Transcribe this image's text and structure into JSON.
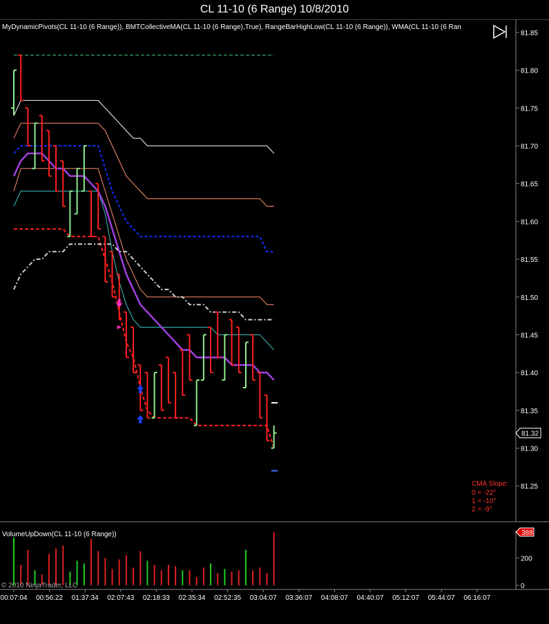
{
  "window": {
    "title": "CL 11-10 (6 Range)  10/8/2010"
  },
  "indicator_legend": "MyDynamicPivots(CL 11-10 (6 Range)), BMTCollectiveMA(CL 11-10 (6 Range),True), RangeBarHighLow(CL 11-10 (6 Range)), WMA(CL 11-10 (6 Ran",
  "volume_legend": "VolumeUpDown(CL 11-10 (6 Range))",
  "copyright": "© 2010 NinjaTrader, LLC",
  "last_price_label": "81.32",
  "last_volume_label": "388",
  "cma_slope": {
    "title": "CMA Slope:",
    "lines": [
      "0 = -22°",
      "1 = -10°",
      "2 = -9°"
    ]
  },
  "colors": {
    "up_bar": "#90ee90",
    "down_bar": "#ff2020",
    "pivot_top": "#2e8b57",
    "wma": "#a040e0",
    "dashed_blue": "#1030ff",
    "support_red": "#ff2020",
    "gray_ma": "#d0d0d0",
    "vol_up": "#20d020",
    "vol_down": "#e02020"
  },
  "chart_data": [
    {
      "type": "candlestick",
      "title": "CL 11-10 (6 Range)  10/8/2010",
      "ylim": [
        81.22,
        81.86
      ],
      "y_ticks": [
        81.85,
        81.8,
        81.75,
        81.7,
        81.65,
        81.6,
        81.55,
        81.5,
        81.45,
        81.4,
        81.35,
        81.3,
        81.25
      ],
      "x_tick_labels": [
        "00:07:04",
        "00:56:22",
        "01:37:34",
        "02:07:43",
        "02:18:33",
        "02:35:34",
        "02:52:35",
        "03:04:07",
        "03:36:07",
        "04:08:07",
        "04:40:07",
        "05:12:07",
        "05:44:07",
        "06:16:07"
      ],
      "bars": [
        {
          "o": 81.75,
          "h": 81.8,
          "l": 81.74,
          "c": 81.8
        },
        {
          "o": 81.82,
          "h": 81.82,
          "l": 81.76,
          "c": 81.76
        },
        {
          "o": 81.75,
          "h": 81.75,
          "l": 81.7,
          "c": 81.7
        },
        {
          "o": 81.67,
          "h": 81.73,
          "l": 81.67,
          "c": 81.73
        },
        {
          "o": 81.74,
          "h": 81.74,
          "l": 81.68,
          "c": 81.68
        },
        {
          "o": 81.72,
          "h": 81.72,
          "l": 81.66,
          "c": 81.66
        },
        {
          "o": 81.7,
          "h": 81.7,
          "l": 81.64,
          "c": 81.64
        },
        {
          "o": 81.68,
          "h": 81.68,
          "l": 81.62,
          "c": 81.62
        },
        {
          "o": 81.58,
          "h": 81.64,
          "l": 81.58,
          "c": 81.64
        },
        {
          "o": 81.61,
          "h": 81.67,
          "l": 81.61,
          "c": 81.67
        },
        {
          "o": 81.64,
          "h": 81.7,
          "l": 81.64,
          "c": 81.7
        },
        {
          "o": 81.64,
          "h": 81.64,
          "l": 81.58,
          "c": 81.58
        },
        {
          "o": 81.65,
          "h": 81.65,
          "l": 81.59,
          "c": 81.59
        },
        {
          "o": 81.58,
          "h": 81.58,
          "l": 81.52,
          "c": 81.52
        },
        {
          "o": 81.56,
          "h": 81.56,
          "l": 81.5,
          "c": 81.5
        },
        {
          "o": 81.53,
          "h": 81.53,
          "l": 81.47,
          "c": 81.47
        },
        {
          "o": 81.48,
          "h": 81.48,
          "l": 81.42,
          "c": 81.42
        },
        {
          "o": 81.46,
          "h": 81.46,
          "l": 81.4,
          "c": 81.4
        },
        {
          "o": 81.41,
          "h": 81.41,
          "l": 81.35,
          "c": 81.35
        },
        {
          "o": 81.4,
          "h": 81.4,
          "l": 81.34,
          "c": 81.34
        },
        {
          "o": 81.34,
          "h": 81.4,
          "l": 81.34,
          "c": 81.4
        },
        {
          "o": 81.41,
          "h": 81.41,
          "l": 81.35,
          "c": 81.35
        },
        {
          "o": 81.42,
          "h": 81.42,
          "l": 81.36,
          "c": 81.36
        },
        {
          "o": 81.4,
          "h": 81.4,
          "l": 81.34,
          "c": 81.34
        },
        {
          "o": 81.43,
          "h": 81.43,
          "l": 81.37,
          "c": 81.37
        },
        {
          "o": 81.45,
          "h": 81.45,
          "l": 81.39,
          "c": 81.39
        },
        {
          "o": 81.33,
          "h": 81.39,
          "l": 81.33,
          "c": 81.39
        },
        {
          "o": 81.39,
          "h": 81.45,
          "l": 81.39,
          "c": 81.45
        },
        {
          "o": 81.46,
          "h": 81.46,
          "l": 81.4,
          "c": 81.4
        },
        {
          "o": 81.48,
          "h": 81.48,
          "l": 81.42,
          "c": 81.42
        },
        {
          "o": 81.39,
          "h": 81.45,
          "l": 81.39,
          "c": 81.45
        },
        {
          "o": 81.47,
          "h": 81.47,
          "l": 81.41,
          "c": 81.41
        },
        {
          "o": 81.46,
          "h": 81.46,
          "l": 81.4,
          "c": 81.4
        },
        {
          "o": 81.38,
          "h": 81.44,
          "l": 81.38,
          "c": 81.44
        },
        {
          "o": 81.45,
          "h": 81.45,
          "l": 81.39,
          "c": 81.39
        },
        {
          "o": 81.4,
          "h": 81.4,
          "l": 81.34,
          "c": 81.34
        },
        {
          "o": 81.37,
          "h": 81.37,
          "l": 81.31,
          "c": 81.31
        },
        {
          "o": 81.3,
          "h": 81.33,
          "l": 81.3,
          "c": 81.32
        }
      ],
      "series": [
        {
          "values": [
            81.82,
            81.82,
            81.82,
            81.82,
            81.82,
            81.82,
            81.82,
            81.82,
            81.82,
            81.82,
            81.82,
            81.82,
            81.82,
            81.82,
            81.82,
            81.82,
            81.82,
            81.82,
            81.82,
            81.82,
            81.82,
            81.82,
            81.82,
            81.82,
            81.82,
            81.82,
            81.82,
            81.82,
            81.82,
            81.82,
            81.82,
            81.82,
            81.82,
            81.82,
            81.82,
            81.82,
            81.82,
            81.82
          ]
        },
        {
          "values": [
            81.74,
            81.76,
            81.76,
            81.76,
            81.76,
            81.76,
            81.76,
            81.76,
            81.76,
            81.76,
            81.76,
            81.76,
            81.76,
            81.75,
            81.74,
            81.73,
            81.72,
            81.71,
            81.71,
            81.7,
            81.7,
            81.7,
            81.7,
            81.7,
            81.7,
            81.7,
            81.7,
            81.7,
            81.7,
            81.7,
            81.7,
            81.7,
            81.7,
            81.7,
            81.7,
            81.7,
            81.7,
            81.69
          ]
        },
        {
          "values": [
            81.71,
            81.73,
            81.73,
            81.73,
            81.73,
            81.73,
            81.73,
            81.73,
            81.73,
            81.73,
            81.73,
            81.73,
            81.73,
            81.72,
            81.7,
            81.68,
            81.66,
            81.65,
            81.64,
            81.63,
            81.63,
            81.63,
            81.63,
            81.63,
            81.63,
            81.63,
            81.63,
            81.63,
            81.63,
            81.63,
            81.63,
            81.63,
            81.63,
            81.63,
            81.63,
            81.63,
            81.62,
            81.62
          ]
        },
        {
          "values": [
            81.69,
            81.7,
            81.7,
            81.7,
            81.7,
            81.7,
            81.7,
            81.7,
            81.7,
            81.7,
            81.7,
            81.7,
            81.7,
            81.67,
            81.64,
            81.62,
            81.6,
            81.59,
            81.58,
            81.58,
            81.58,
            81.58,
            81.58,
            81.58,
            81.58,
            81.58,
            81.58,
            81.58,
            81.58,
            81.58,
            81.58,
            81.58,
            81.58,
            81.58,
            81.58,
            81.58,
            81.56,
            81.56
          ]
        },
        {
          "values": [
            81.64,
            81.67,
            81.67,
            81.67,
            81.67,
            81.67,
            81.67,
            81.67,
            81.67,
            81.67,
            81.67,
            81.67,
            81.67,
            81.64,
            81.61,
            81.58,
            81.55,
            81.53,
            81.51,
            81.5,
            81.5,
            81.5,
            81.5,
            81.5,
            81.5,
            81.5,
            81.5,
            81.5,
            81.5,
            81.5,
            81.5,
            81.5,
            81.5,
            81.5,
            81.5,
            81.5,
            81.49,
            81.49
          ]
        },
        {
          "values": [
            81.62,
            81.64,
            81.64,
            81.64,
            81.64,
            81.64,
            81.64,
            81.64,
            81.64,
            81.64,
            81.64,
            81.64,
            81.64,
            81.61,
            81.56,
            81.52,
            81.49,
            81.47,
            81.46,
            81.46,
            81.46,
            81.46,
            81.46,
            81.46,
            81.46,
            81.46,
            81.46,
            81.46,
            81.46,
            81.45,
            81.45,
            81.45,
            81.45,
            81.45,
            81.45,
            81.45,
            81.44,
            81.43
          ]
        },
        {
          "values": [
            81.66,
            81.68,
            81.69,
            81.69,
            81.69,
            81.68,
            81.67,
            81.67,
            81.66,
            81.66,
            81.66,
            81.65,
            81.64,
            81.62,
            81.59,
            81.56,
            81.53,
            81.51,
            81.49,
            81.48,
            81.47,
            81.46,
            81.45,
            81.44,
            81.43,
            81.43,
            81.42,
            81.42,
            81.42,
            81.42,
            81.42,
            81.41,
            81.41,
            81.41,
            81.41,
            81.4,
            81.4,
            81.39
          ]
        },
        {
          "values": [
            81.59,
            81.59,
            81.59,
            81.59,
            81.59,
            81.59,
            81.59,
            81.59,
            81.58,
            81.58,
            81.58,
            81.58,
            81.58,
            81.55,
            81.52,
            81.48,
            81.44,
            81.42,
            81.38,
            81.35,
            81.34,
            81.34,
            81.34,
            81.34,
            81.34,
            81.34,
            81.33,
            81.33,
            81.33,
            81.33,
            81.33,
            81.33,
            81.33,
            81.33,
            81.33,
            81.33,
            81.33,
            81.3
          ]
        },
        {
          "values": [
            81.51,
            81.53,
            81.54,
            81.55,
            81.55,
            81.56,
            81.56,
            81.56,
            81.57,
            81.57,
            81.57,
            81.57,
            81.57,
            81.57,
            81.57,
            81.56,
            81.56,
            81.55,
            81.54,
            81.53,
            81.52,
            81.51,
            81.51,
            81.5,
            81.5,
            81.49,
            81.49,
            81.49,
            81.48,
            81.48,
            81.48,
            81.48,
            81.48,
            81.47,
            81.47,
            81.47,
            81.47,
            81.47
          ]
        }
      ],
      "markers": [
        {
          "bar": 15,
          "y": 81.49,
          "type": "down-arrow"
        },
        {
          "bar": 15,
          "y": 81.46,
          "type": "down-triangle"
        },
        {
          "bar": 18,
          "y": 81.34,
          "type": "up-arrow"
        },
        {
          "bar": 18,
          "y": 81.38,
          "type": "up-arrow"
        }
      ]
    },
    {
      "type": "bar",
      "title": "VolumeUpDown(CL 11-10 (6 Range))",
      "ylim": [
        0,
        400
      ],
      "y_ticks": [
        0,
        200
      ],
      "values": [
        350,
        150,
        260,
        110,
        80,
        230,
        270,
        290,
        100,
        180,
        160,
        340,
        250,
        200,
        120,
        190,
        220,
        130,
        250,
        180,
        150,
        110,
        150,
        140,
        110,
        110,
        60,
        130,
        160,
        90,
        120,
        100,
        110,
        260,
        110,
        130,
        90,
        388
      ],
      "up": [
        true,
        false,
        false,
        true,
        false,
        false,
        false,
        false,
        true,
        true,
        true,
        false,
        false,
        false,
        false,
        false,
        false,
        false,
        false,
        true,
        false,
        false,
        false,
        false,
        true,
        false,
        false,
        false,
        true,
        false,
        true,
        false,
        false,
        true,
        false,
        false,
        false,
        false
      ]
    }
  ]
}
